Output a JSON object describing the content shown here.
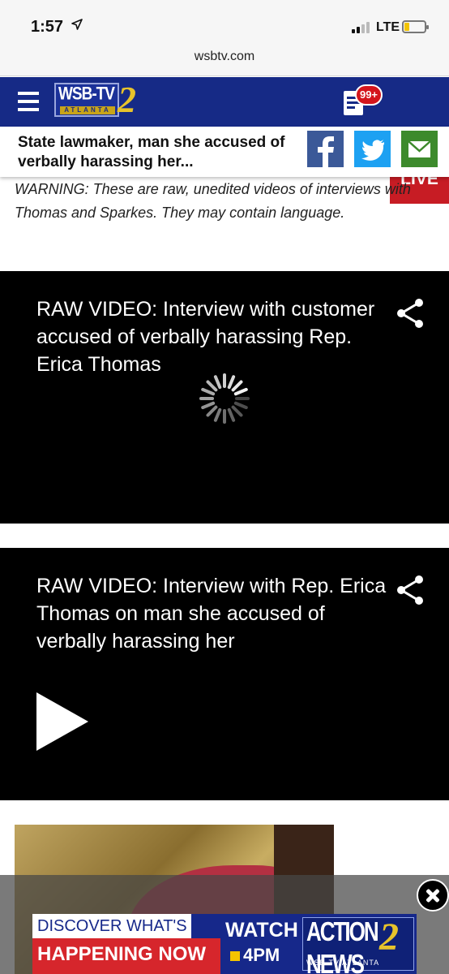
{
  "status": {
    "time": "1:57",
    "network": "LTE",
    "battery_level": 0.25
  },
  "browser": {
    "url": "wsbtv.com"
  },
  "nav": {
    "logo_name": "WSB-TV",
    "logo_city": "ATLANTA",
    "logo_channel": "2",
    "notifications_badge": "99+",
    "live_label": "LIVE"
  },
  "share_bar": {
    "headline": "State lawmaker, man she accused of verbally harassing her...",
    "icons": [
      "facebook-icon",
      "twitter-icon",
      "email-icon"
    ],
    "colors": {
      "facebook": "#3b5998",
      "twitter": "#1da1f2",
      "email": "#3d8a2c"
    }
  },
  "article": {
    "warning": "WARNING: These are raw, unedited videos of interviews with Thomas and Sparkes. They may contain language."
  },
  "videos": [
    {
      "title": "RAW VIDEO: Interview with customer accused of verbally harassing Rep. Erica Thomas",
      "state": "loading"
    },
    {
      "title": "RAW VIDEO: Interview with Rep. Erica Thomas on man she accused of verbally harassing her",
      "state": "paused"
    }
  ],
  "ad": {
    "line1": "DISCOVER WHAT'S",
    "line2": "HAPPENING NOW",
    "watch": "WATCH",
    "time": "4PM",
    "brand": "ACTION NEWS",
    "brand_channel": "2",
    "brand_sub": "WSB-TV ATLANTA"
  },
  "colors": {
    "nav_blue": "#162a86",
    "live_red": "#c71c24",
    "badge_red": "#d4151c",
    "logo_gold": "#e7c32b"
  }
}
